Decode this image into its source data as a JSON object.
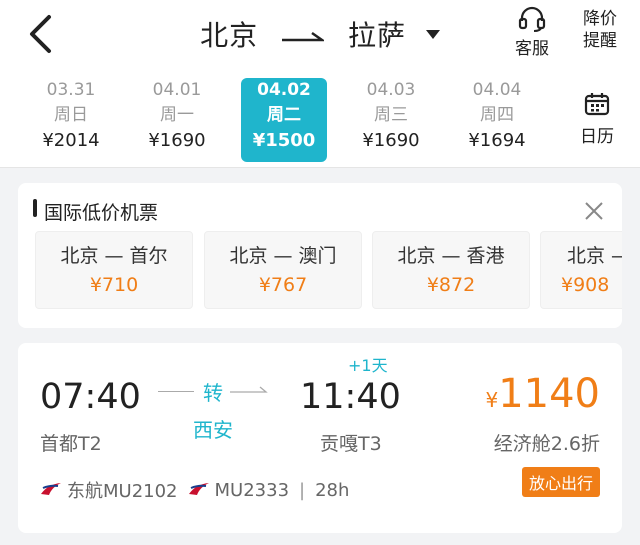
{
  "header": {
    "from": "北京",
    "to": "拉萨",
    "service_label": "客服",
    "alert_label_1": "降价",
    "alert_label_2": "提醒"
  },
  "dates": [
    {
      "date": "03.31",
      "weekday": "周日",
      "price": "¥2014"
    },
    {
      "date": "04.01",
      "weekday": "周一",
      "price": "¥1690"
    },
    {
      "date": "04.02",
      "weekday": "周二",
      "price": "¥1500",
      "selected": true
    },
    {
      "date": "04.03",
      "weekday": "周三",
      "price": "¥1690"
    },
    {
      "date": "04.04",
      "weekday": "周四",
      "price": "¥1694"
    }
  ],
  "calendar_label": "日历",
  "intl": {
    "title": "国际低价机票",
    "routes": [
      {
        "name": "北京 — 首尔",
        "price": "¥710"
      },
      {
        "name": "北京 — 澳门",
        "price": "¥767"
      },
      {
        "name": "北京 — 香港",
        "price": "¥872"
      },
      {
        "name": "北京 —",
        "price": "¥908"
      }
    ]
  },
  "flight": {
    "depart_time": "07:40",
    "depart_airport": "首都T2",
    "transfer_label": "转",
    "transfer_city": "西安",
    "arrive_time": "11:40",
    "arrive_airport": "贡嘎T3",
    "day_offset": "+1天",
    "currency": "¥",
    "price": "1140",
    "cabin": "经济舱2.6折",
    "airline1": "东航MU2102",
    "airline2": "MU2333",
    "duration": "28h",
    "badge": "放心出行"
  },
  "colors": {
    "accent": "#1fb5cc",
    "price": "#f07e17"
  }
}
